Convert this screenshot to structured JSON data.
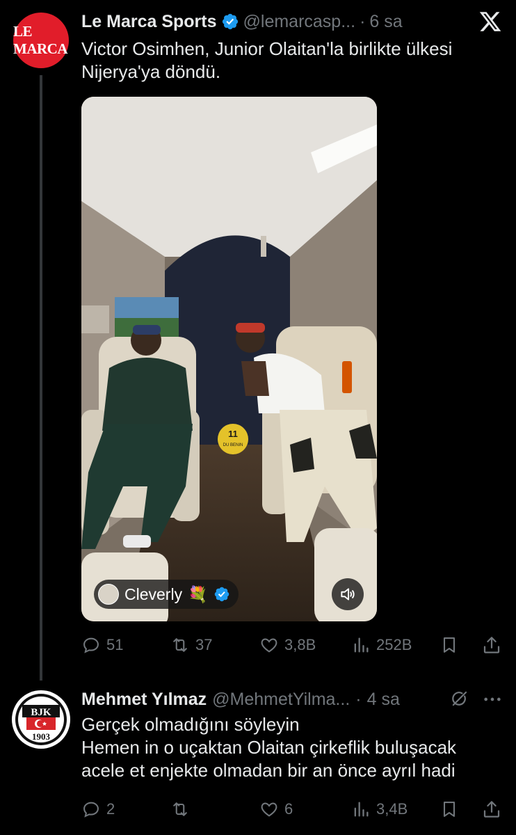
{
  "tweet1": {
    "avatar_text": "LE MARCA",
    "name": "Le Marca Sports",
    "handle": "@lemarcasp...",
    "separator": "·",
    "time": "6 sa",
    "text": "Victor Osimhen, Junior Olaitan'la birlikte ülkesi Nijerya'ya döndü.",
    "media": {
      "watermark_top": "11",
      "watermark_bottom": "DU BENIN",
      "attribution_name": "Cleverly",
      "attribution_emoji": "💐"
    },
    "actions": {
      "replies": "51",
      "reposts": "37",
      "likes": "3,8B",
      "views": "252B"
    }
  },
  "tweet2": {
    "avatar_text_top": "BJK",
    "avatar_text_bottom": "1903",
    "name": "Mehmet Yılmaz",
    "handle": "@MehmetYilma...",
    "separator": "·",
    "time": "4 sa",
    "text_lines": [
      "Gerçek olmadığını söyleyin",
      "Hemen in o uçaktan Olaitan çirkeflik buluşacak",
      "acele et enjekte olmadan bir an önce ayrıl hadi"
    ],
    "actions": {
      "replies": "2",
      "reposts": "",
      "likes": "6",
      "views": "3,4B"
    }
  },
  "colors": {
    "background": "#000000",
    "text": "#e7e9ea",
    "muted": "#71767b",
    "verified": "#1d9bf0",
    "brand_red": "#e11d2a"
  },
  "icons": [
    "verified-badge-icon",
    "x-logo-icon",
    "volume-icon",
    "reply-icon",
    "repost-icon",
    "like-icon",
    "views-icon",
    "bookmark-icon",
    "share-icon",
    "grok-icon",
    "more-icon"
  ]
}
